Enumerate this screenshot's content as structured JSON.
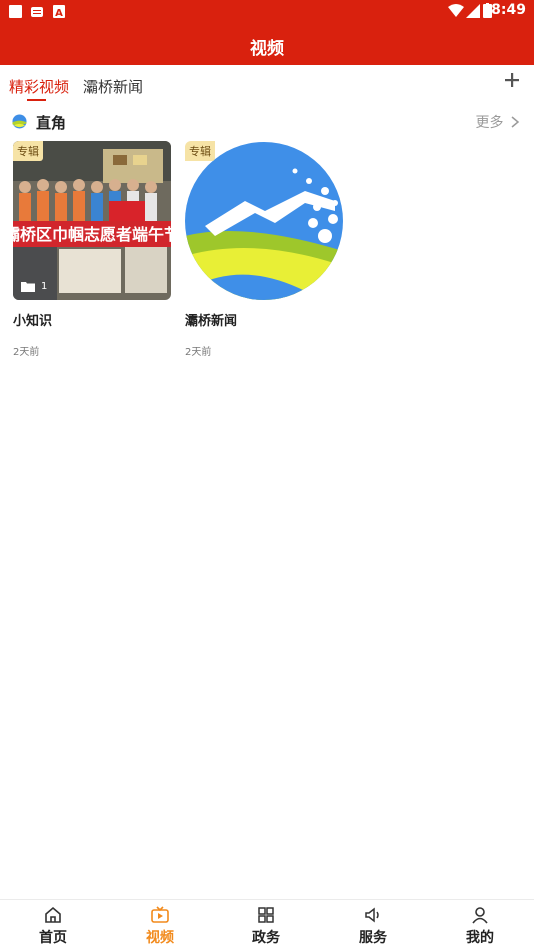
{
  "status_bar": {
    "time": "8:49"
  },
  "header": {
    "title": "视频"
  },
  "tabs": [
    {
      "label": "精彩视频"
    },
    {
      "label": "灞桥新闻"
    }
  ],
  "section": {
    "title": "直角",
    "more_label": "更多"
  },
  "cards": [
    {
      "badge": "专辑",
      "title": "小知识",
      "time": "2天前",
      "count": "1",
      "banner_text": "灞桥区巾帼志愿者端午节"
    },
    {
      "badge": "专辑",
      "title": "灞桥新闻",
      "time": "2天前"
    }
  ],
  "bottom_nav": [
    {
      "label": "首页",
      "icon": "home-icon"
    },
    {
      "label": "视频",
      "icon": "tv-icon"
    },
    {
      "label": "政务",
      "icon": "grid-icon"
    },
    {
      "label": "服务",
      "icon": "speaker-icon"
    },
    {
      "label": "我的",
      "icon": "person-icon"
    }
  ],
  "colors": {
    "brand": "#d9210e",
    "nav_active": "#f28a1c",
    "badge": "#f6e3a6"
  }
}
